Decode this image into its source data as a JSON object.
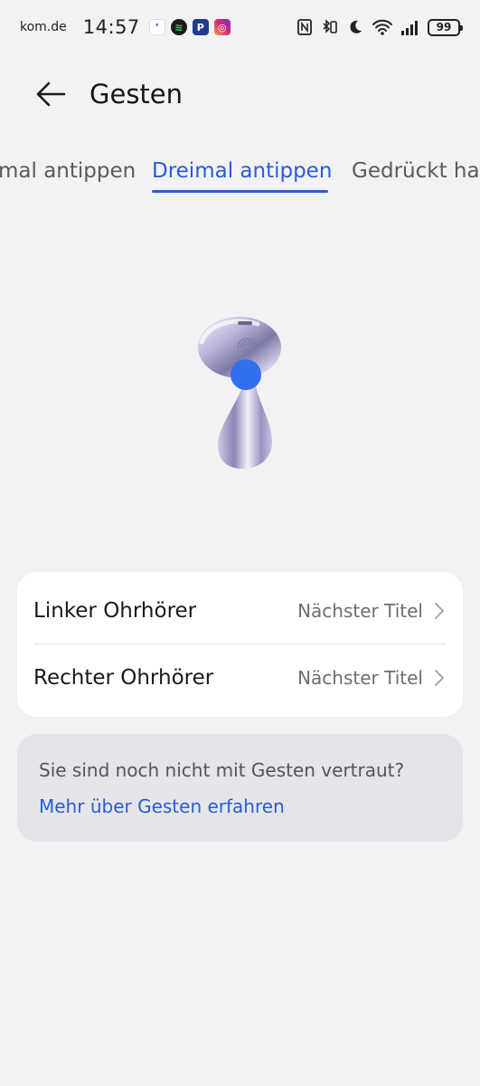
{
  "status_bar": {
    "carrier": "kom.de",
    "time": "14:57",
    "apps": [
      "messenger-icon",
      "spotify-icon",
      "paypal-icon",
      "instagram-icon"
    ],
    "battery": "99"
  },
  "header": {
    "title": "Gesten",
    "back_icon": "arrow-left-icon"
  },
  "tabs": [
    {
      "label": "Zweimal antippen",
      "visible_text": "mal antippen",
      "active": false
    },
    {
      "label": "Dreimal antippen",
      "active": true
    },
    {
      "label": "Gedrückt halten",
      "visible_text": "Gedrückt hal",
      "active": false
    }
  ],
  "earbud": {
    "icon": "earbud-icon",
    "highlight_color": "#2f6ff0"
  },
  "settings": [
    {
      "label": "Linker Ohrhörer",
      "value": "Nächster Titel"
    },
    {
      "label": "Rechter Ohrhörer",
      "value": "Nächster Titel"
    }
  ],
  "info": {
    "text": "Sie sind noch nicht mit Gesten vertraut?",
    "link": "Mehr über Gesten erfahren"
  },
  "colors": {
    "accent": "#2a5bd7",
    "background": "#f1f2f4",
    "card": "#ffffff",
    "info_bg": "#e4e5e8"
  }
}
